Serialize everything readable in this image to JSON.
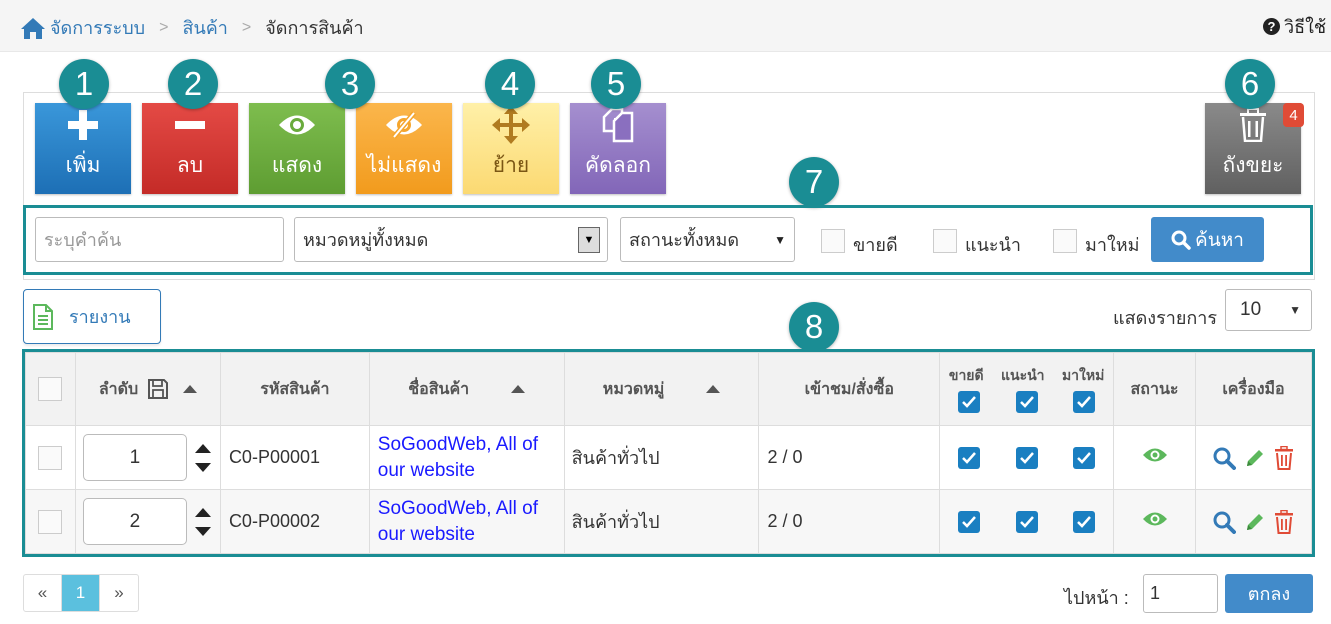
{
  "breadcrumb": {
    "home": "จัดการระบบ",
    "section": "สินค้า",
    "current": "จัดการสินค้า"
  },
  "help_label": "วิธีใช้",
  "toolbar": {
    "add": "เพิ่ม",
    "delete": "ลบ",
    "show": "แสดง",
    "hide": "ไม่แสดง",
    "move": "ย้าย",
    "copy": "คัดลอก",
    "trash": "ถังขยะ",
    "trash_count": "4"
  },
  "markers": [
    "1",
    "2",
    "3",
    "4",
    "5",
    "6",
    "7",
    "8"
  ],
  "search": {
    "placeholder": "ระบุคำค้น",
    "category": "หมวดหมู่ทั้งหมด",
    "status": "สถานะทั้งหมด",
    "bestseller": "ขายดี",
    "recommended": "แนะนำ",
    "new": "มาใหม่",
    "button": "ค้นหา"
  },
  "report_label": "รายงาน",
  "per_page": {
    "label": "แสดงรายการ",
    "value": "10"
  },
  "table": {
    "headers": {
      "order": "ลำดับ",
      "code": "รหัสสินค้า",
      "name": "ชื่อสินค้า",
      "category": "หมวดหมู่",
      "views": "เข้าชม/สั่งซื้อ",
      "bestseller": "ขายดี",
      "recommended": "แนะนำ",
      "new": "มาใหม่",
      "status": "สถานะ",
      "tools": "เครื่องมือ"
    },
    "rows": [
      {
        "order": "1",
        "code": "C0-P00001",
        "name": "SoGoodWeb, All of our website",
        "category": "สินค้าทั่วไป",
        "views": "2 / 0"
      },
      {
        "order": "2",
        "code": "C0-P00002",
        "name": "SoGoodWeb, All of our website",
        "category": "สินค้าทั่วไป",
        "views": "2 / 0"
      }
    ]
  },
  "pagination": {
    "prev": "«",
    "current": "1",
    "next": "»"
  },
  "goto": {
    "label": "ไปหน้า :",
    "value": "1",
    "button": "ตกลง"
  },
  "colors": {
    "accent": "#1a8d94",
    "primary": "#428bca",
    "link": "#1a1aff"
  }
}
